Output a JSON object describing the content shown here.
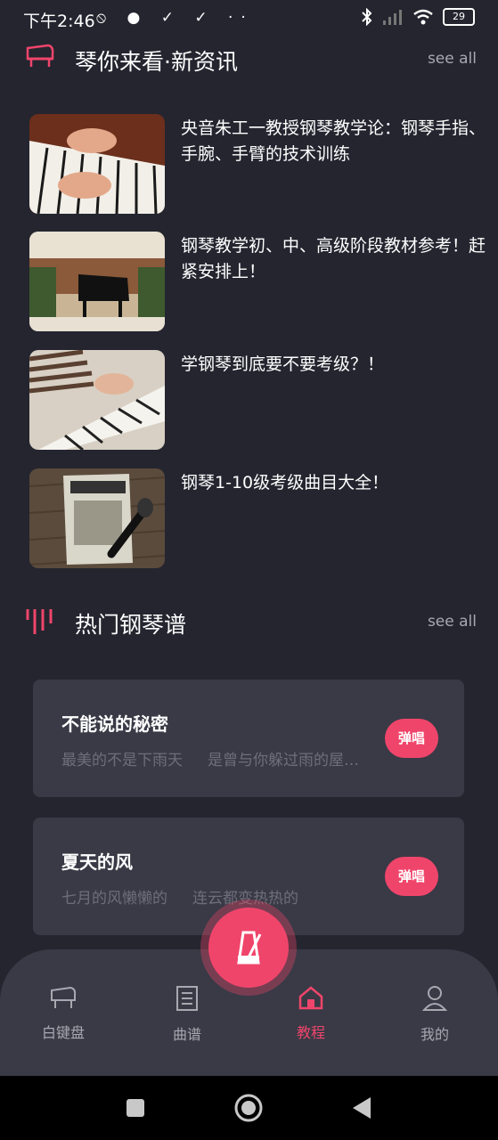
{
  "status_bar": {
    "time": "下午2:46",
    "battery": "29"
  },
  "news_section": {
    "title": "琴你来看·新资讯",
    "see_all": "see all",
    "items": [
      {
        "title": "央音朱工一教授钢琴教学论：钢琴手指、手腕、手臂的技术训练"
      },
      {
        "title": "钢琴教学初、中、高级阶段教材参考！赶紧安排上！"
      },
      {
        "title": "学钢琴到底要不要考级？！"
      },
      {
        "title": "钢琴1-10级考级曲目大全！"
      }
    ]
  },
  "scores_section": {
    "title": "热门钢琴谱",
    "see_all": "see all",
    "songs": [
      {
        "title": "不能说的秘密",
        "lyric_1": "最美的不是下雨天",
        "lyric_2": "是曾与你躲过雨的屋…",
        "button": "弹唱"
      },
      {
        "title": "夏天的风",
        "lyric_1": "七月的风懒懒的",
        "lyric_2": "连云都变热热的",
        "button": "弹唱"
      }
    ]
  },
  "tab_bar": {
    "tabs": [
      {
        "label": "白键盘",
        "icon": "piano-icon"
      },
      {
        "label": "曲谱",
        "icon": "sheet-music-icon"
      },
      {
        "label": "教程",
        "icon": "home-icon"
      },
      {
        "label": "我的",
        "icon": "profile-icon"
      }
    ],
    "active_tab": "教程",
    "center_button_icon": "metronome-icon"
  },
  "colors": {
    "accent": "#f0456b",
    "background": "#24252f",
    "card": "#393a46"
  }
}
